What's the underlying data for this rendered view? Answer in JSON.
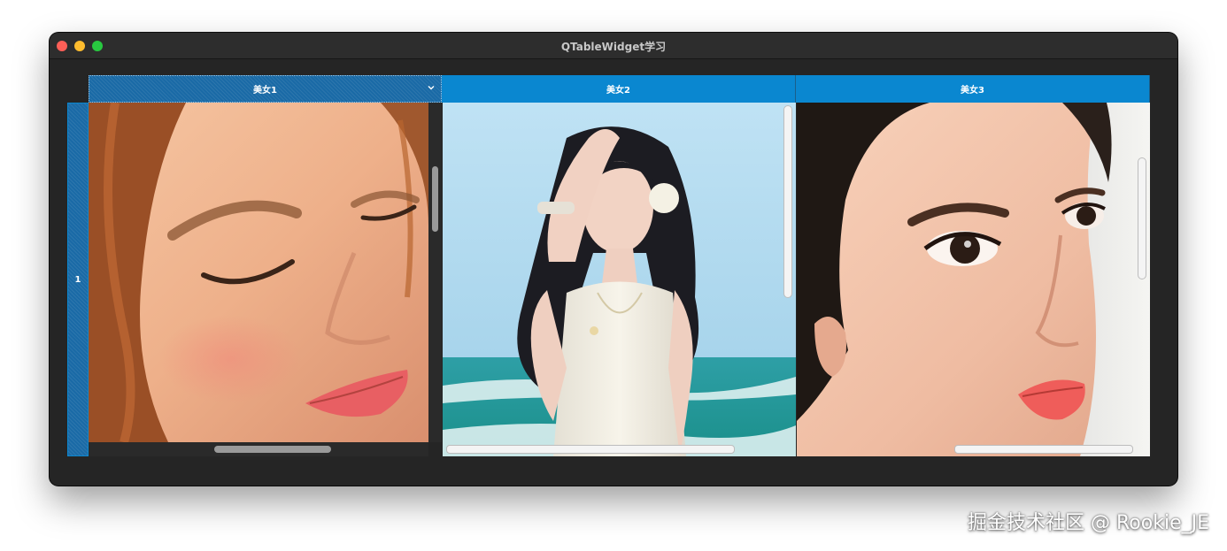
{
  "window": {
    "title": "QTableWidget学习"
  },
  "table": {
    "columns": [
      {
        "label": "美女1",
        "icon": "chevron-down-icon",
        "image": "photo of woman with eyes closed, close-up face"
      },
      {
        "label": "美女2",
        "image": "photo of woman in white dress at the beach"
      },
      {
        "label": "美女3",
        "image": "close-up portrait of woman with dark hair"
      }
    ],
    "rows": [
      {
        "label": "1"
      }
    ],
    "colors": {
      "header": "#0a87d0",
      "header_selected": "#1a6aa6",
      "window_bg": "#252525"
    }
  },
  "watermark": "掘金技术社区 @ Rookie_JE"
}
